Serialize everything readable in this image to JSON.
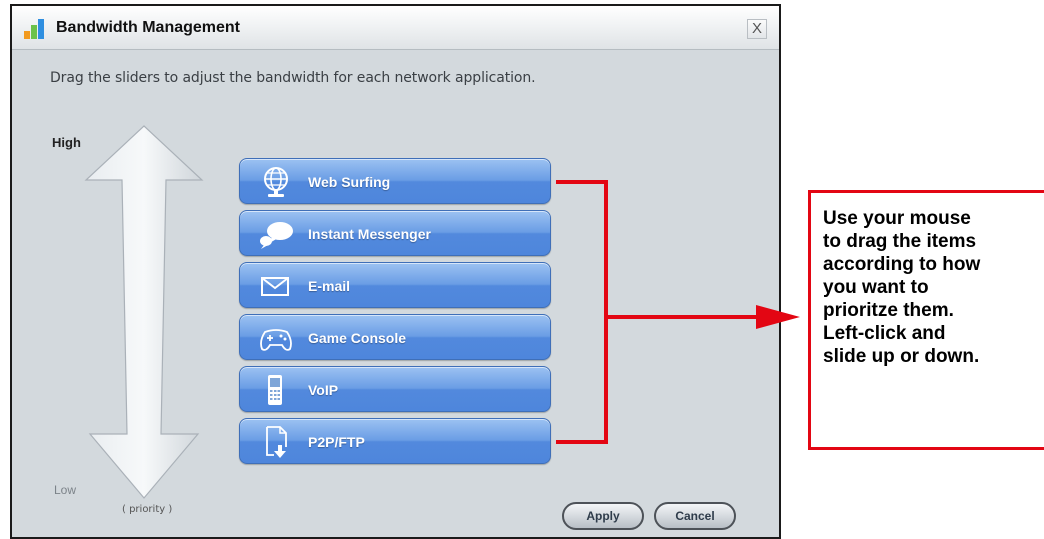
{
  "dialog": {
    "title": "Bandwidth Management",
    "close_label": "X",
    "instruction": "Drag the sliders to adjust the bandwidth for each network application.",
    "scale": {
      "high_label": "High",
      "low_label": "Low",
      "priority_label": "( priority )"
    },
    "applications": [
      {
        "label": "Web Surfing",
        "icon": "globe-icon"
      },
      {
        "label": "Instant Messenger",
        "icon": "chat-bubble-icon"
      },
      {
        "label": "E-mail",
        "icon": "envelope-icon"
      },
      {
        "label": "Game Console",
        "icon": "gamepad-icon"
      },
      {
        "label": "VoIP",
        "icon": "phone-icon"
      },
      {
        "label": "P2P/FTP",
        "icon": "file-download-icon"
      }
    ],
    "buttons": {
      "apply": "Apply",
      "cancel": "Cancel"
    }
  },
  "callout": {
    "lines": [
      "Use your mouse",
      "to drag the items",
      "according to how",
      "you want to",
      "prioritze them.",
      "Left-click and",
      "slide up or down."
    ]
  },
  "colors": {
    "accent_red": "#e30613",
    "item_blue": "#5289dd",
    "dialog_bg": "#d3d9dd"
  }
}
